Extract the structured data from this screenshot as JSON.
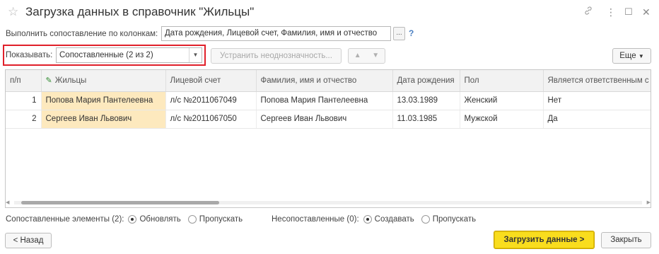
{
  "window": {
    "title": "Загрузка данных в справочник \"Жильцы\"",
    "icons": [
      "star-icon",
      "link-icon",
      "more-icon",
      "maximize-icon",
      "close-icon"
    ]
  },
  "mapping": {
    "label": "Выполнить сопоставление по колонкам:",
    "value": "Дата рождения, Лицевой счет, Фамилия, имя и отчество",
    "choose_label": "...",
    "help_label": "?"
  },
  "filter": {
    "label": "Показывать:",
    "selected": "Сопоставленные (2 из 2)",
    "resolve_label": "Устранить неоднозначность...",
    "more_label": "Еще"
  },
  "table": {
    "columns": [
      "п/п",
      "Жильцы",
      "Лицевой счет",
      "Фамилия, имя и отчество",
      "Дата рождения",
      "Пол",
      "Является ответственным с"
    ],
    "rows": [
      [
        "1",
        "Попова Мария Пантелеевна",
        "л/с №2011067049",
        "Попова Мария Пантелеевна",
        "13.03.1989",
        "Женский",
        "Нет"
      ],
      [
        "2",
        "Сергеев Иван Львович",
        "л/с №2011067050",
        "Сергеев Иван Львович",
        "11.03.1985",
        "Мужской",
        "Да"
      ]
    ]
  },
  "options": {
    "matched_label": "Сопоставленные элементы (2):",
    "matched_update": "Обновлять",
    "matched_skip": "Пропускать",
    "matched_selected": "Обновлять",
    "unmatched_label": "Несопоставленные (0):",
    "unmatched_create": "Создавать",
    "unmatched_skip": "Пропускать",
    "unmatched_selected": "Создавать"
  },
  "buttons": {
    "back": "< Назад",
    "load": "Загрузить данные >",
    "close": "Закрыть"
  },
  "colors": {
    "highlight_border": "#e0202a",
    "primary_button": "#f9dd1e",
    "resolved_cell": "#fde9be"
  }
}
